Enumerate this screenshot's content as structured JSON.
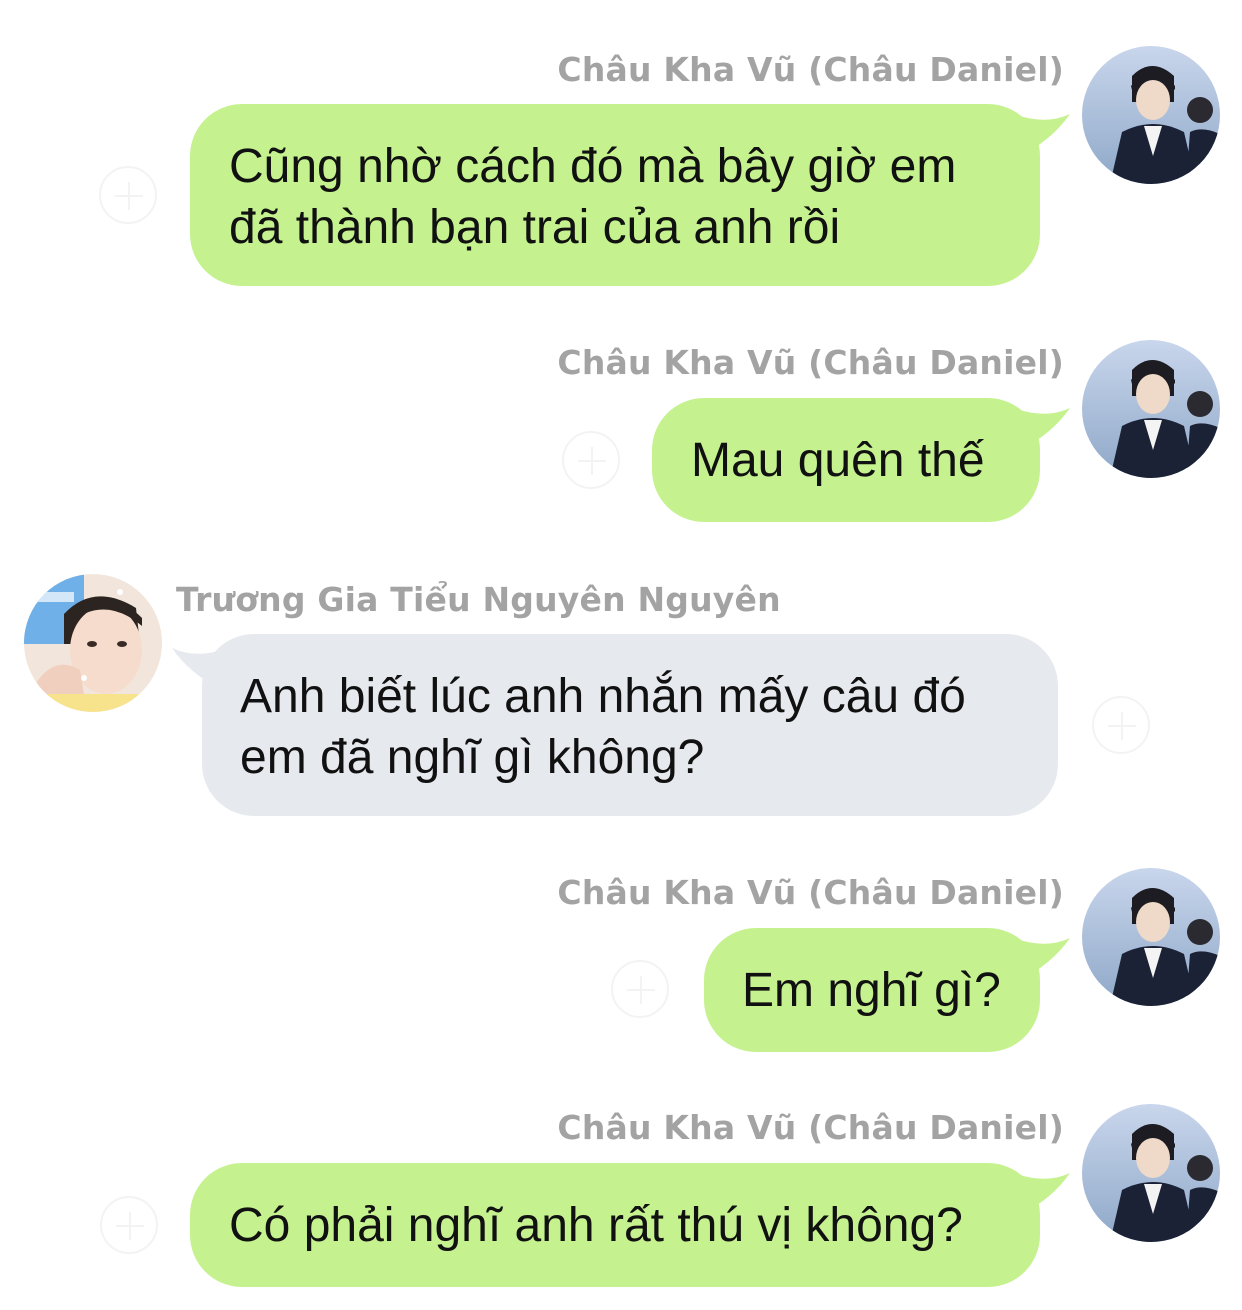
{
  "messages": [
    {
      "sender": "Châu Kha Vũ (Châu Daniel)",
      "side": "right",
      "lines": [
        "Cũng nhờ cách đó mà bây giờ em",
        "đã thành bạn trai của anh rồi"
      ]
    },
    {
      "sender": "Châu Kha Vũ (Châu Daniel)",
      "side": "right",
      "lines": [
        "Mau quên thế"
      ]
    },
    {
      "sender": "Trương Gia Tiểu Nguyên Nguyên",
      "side": "left",
      "lines": [
        "Anh biết lúc anh nhắn mấy câu đó",
        "em đã nghĩ gì không?"
      ]
    },
    {
      "sender": "Châu Kha Vũ (Châu Daniel)",
      "side": "right",
      "lines": [
        "Em nghĩ gì?"
      ]
    },
    {
      "sender": "Châu Kha Vũ (Châu Daniel)",
      "side": "right",
      "lines": [
        "Có phải nghĩ anh rất thú vị không?"
      ]
    }
  ],
  "colors": {
    "outgoing_bubble": "#c5f28f",
    "incoming_bubble": "#e6e9ee",
    "sender_name": "#a3a3a3"
  },
  "icons": {
    "avatar_right": "avatar-icon",
    "avatar_left": "avatar-icon",
    "react_button": "add-reaction-icon"
  }
}
